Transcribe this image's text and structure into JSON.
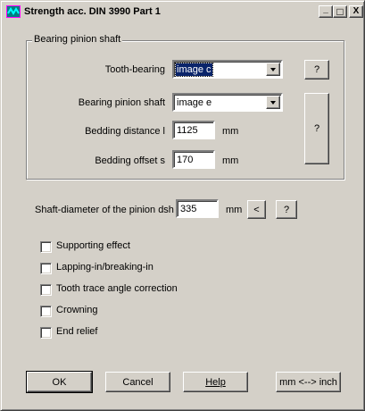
{
  "window": {
    "title": "Strength acc. DIN 3990 Part 1",
    "minimize_glyph": "_",
    "maximize_glyph": "□",
    "close_glyph": "X"
  },
  "group": {
    "label": "Bearing pinion shaft",
    "tooth_bearing": {
      "label": "Tooth-bearing",
      "value": "image c",
      "help": "?"
    },
    "bearing_pinion_shaft": {
      "label": "Bearing pinion shaft",
      "value": "image e"
    },
    "bedding_distance": {
      "label": "Bedding distance l",
      "value": "1125",
      "unit": "mm"
    },
    "bedding_offset": {
      "label": "Bedding offset s",
      "value": "170",
      "unit": "mm"
    },
    "help": "?"
  },
  "shaft": {
    "label": "Shaft-diameter of the pinion dsh",
    "value": "335",
    "unit": "mm",
    "back_button": "<",
    "help": "?"
  },
  "options": [
    {
      "label": "Supporting effect",
      "checked": false
    },
    {
      "label": "Lapping-in/breaking-in",
      "checked": false
    },
    {
      "label": "Tooth trace angle correction",
      "checked": false
    },
    {
      "label": "Crowning",
      "checked": false
    },
    {
      "label": "End relief",
      "checked": false
    }
  ],
  "buttons": {
    "ok": "OK",
    "cancel": "Cancel",
    "help": "Help",
    "units": "mm <--> inch"
  },
  "colors": {
    "face": "#d4d0c8",
    "selection": "#0a246a"
  }
}
